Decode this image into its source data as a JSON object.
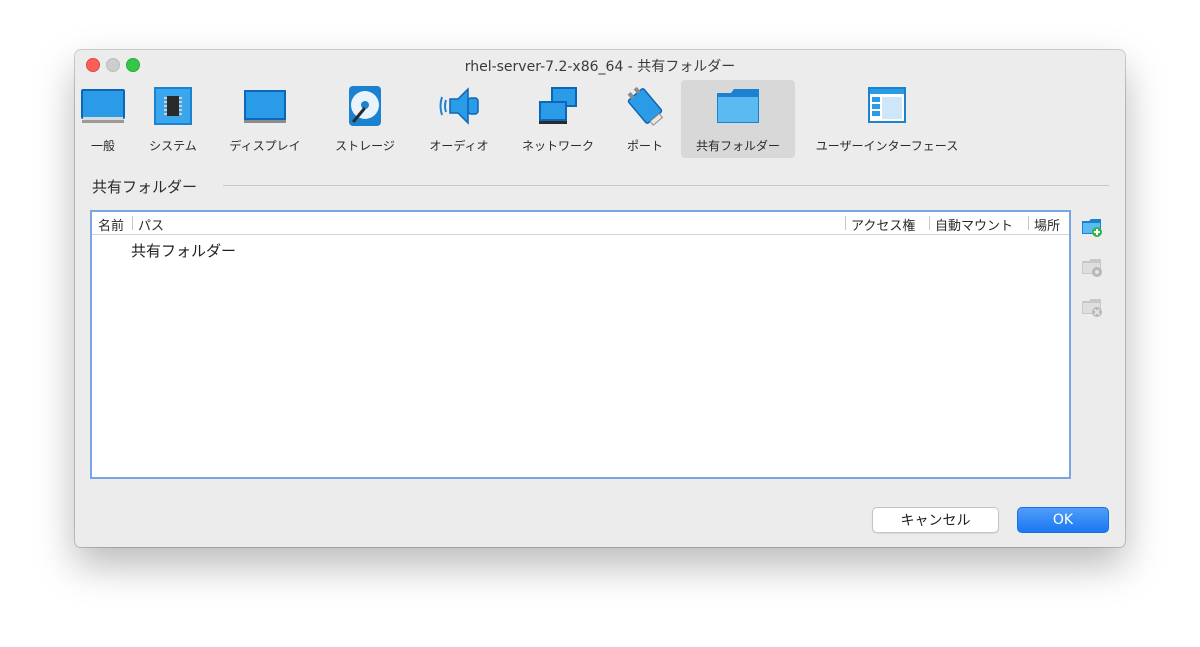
{
  "window": {
    "title": "rhel-server-7.2-x86_64 - 共有フォルダー"
  },
  "toolbar": {
    "items": [
      {
        "label": "一般",
        "icon": "general-icon"
      },
      {
        "label": "システム",
        "icon": "system-chip-icon"
      },
      {
        "label": "ディスプレイ",
        "icon": "display-icon"
      },
      {
        "label": "ストレージ",
        "icon": "storage-disk-icon"
      },
      {
        "label": "オーディオ",
        "icon": "audio-speaker-icon"
      },
      {
        "label": "ネットワーク",
        "icon": "network-icon"
      },
      {
        "label": "ポート",
        "icon": "port-plug-icon"
      },
      {
        "label": "共有フォルダー",
        "icon": "shared-folder-icon",
        "selected": true
      },
      {
        "label": "ユーザーインターフェース",
        "icon": "user-interface-icon"
      }
    ]
  },
  "section": {
    "label": "共有フォルダー"
  },
  "table": {
    "columns": [
      "名前",
      "パス",
      "アクセス権",
      "自動マウント",
      "場所"
    ],
    "rows": [
      {
        "text": "共有フォルダー"
      }
    ]
  },
  "side_buttons": [
    {
      "icon": "add-shared-folder-icon",
      "enabled": true
    },
    {
      "icon": "edit-shared-folder-icon",
      "enabled": false
    },
    {
      "icon": "remove-shared-folder-icon",
      "enabled": false
    }
  ],
  "buttons": {
    "cancel": "キャンセル",
    "ok": "OK"
  },
  "colors": {
    "accent": "#1a78f2",
    "focus_border": "#7aa5e3",
    "icon_blue": "#1e8ad6"
  }
}
